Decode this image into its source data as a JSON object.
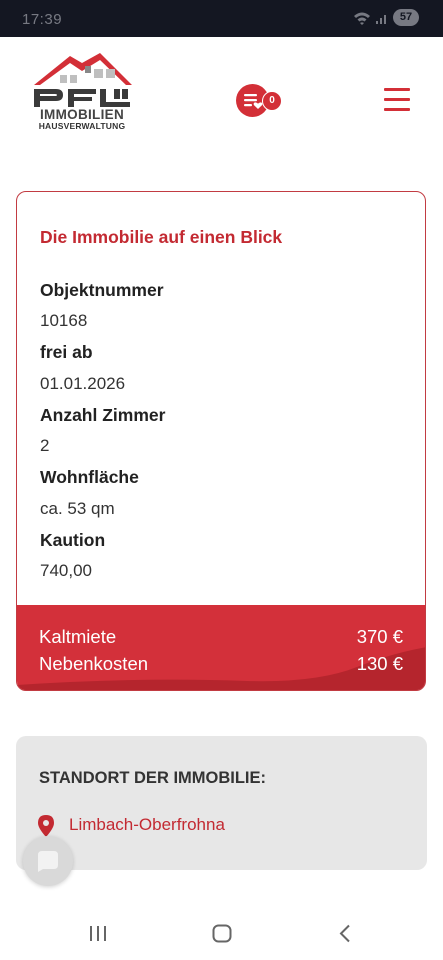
{
  "status_bar": {
    "time": "17:39",
    "battery": "57"
  },
  "logo": {
    "brand": "IMMOBILIEN",
    "subtitle": "HAUSVERWALTUNG",
    "mark": "PFL"
  },
  "header": {
    "favorites_count": "0",
    "menu_icon": "hamburger-icon",
    "favorites_icon": "favorites-list-icon"
  },
  "overview": {
    "title": "Die Immobilie auf einen Blick",
    "facts": [
      {
        "label": "Objektnummer",
        "value": "10168"
      },
      {
        "label": "frei ab",
        "value": "01.01.2026"
      },
      {
        "label": "Anzahl Zimmer",
        "value": "2"
      },
      {
        "label": "Wohnfläche",
        "value": "ca. 53 qm"
      },
      {
        "label": "Kaution",
        "value": "740,00"
      }
    ],
    "prices": [
      {
        "label": "Kaltmiete",
        "value": "370 €"
      },
      {
        "label": "Nebenkosten",
        "value": "130 €"
      }
    ]
  },
  "location": {
    "title": "STANDORT DER IMMOBILIE:",
    "city": "Limbach-Oberfrohna",
    "icon": "map-pin-icon"
  },
  "colors": {
    "accent": "#d32f37",
    "panel": "#e7e7e7",
    "status_bar": "#141722"
  }
}
